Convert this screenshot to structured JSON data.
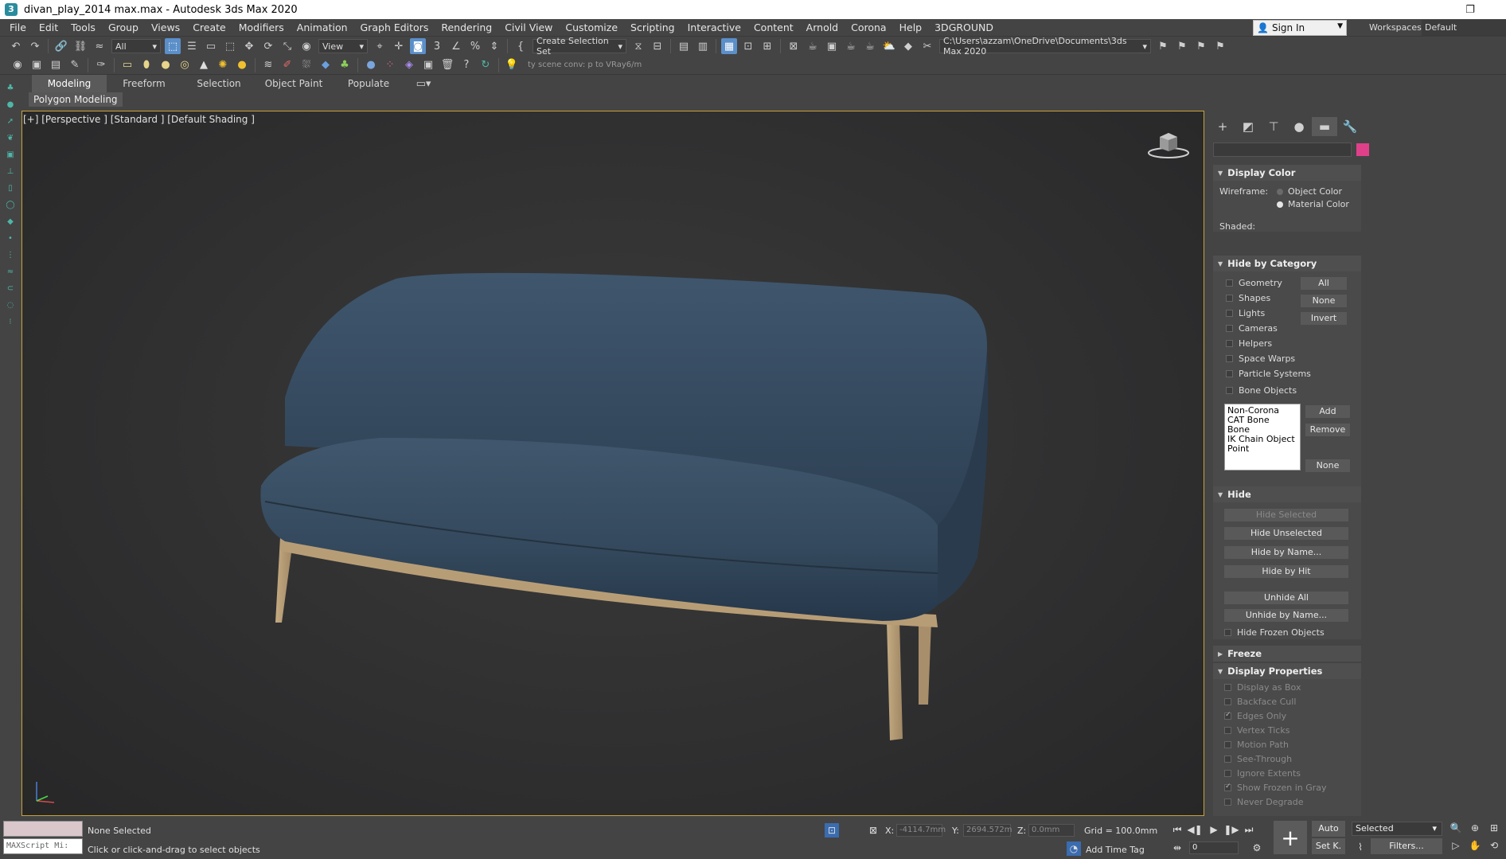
{
  "window": {
    "title": "divan_play_2014 max.max - Autodesk 3ds Max 2020",
    "restore_glyph": "❐"
  },
  "menu": [
    "File",
    "Edit",
    "Tools",
    "Group",
    "Views",
    "Create",
    "Modifiers",
    "Animation",
    "Graph Editors",
    "Rendering",
    "Civil View",
    "Customize",
    "Scripting",
    "Interactive",
    "Content",
    "Arnold",
    "Corona",
    "Help",
    "3DGROUND"
  ],
  "account": {
    "sign_in": "Sign In",
    "workspaces_label": "Workspaces:",
    "workspace": "Default"
  },
  "toolbar1": {
    "selection_filter": "All",
    "ref_coord": "View",
    "selection_set": "Create Selection Set",
    "project_path": "C:\\Users\\azzam\\OneDrive\\Documents\\3ds Max 2020"
  },
  "toolbar2": {
    "hint": "ty scene conv: p to VRay6/m"
  },
  "ribbon": {
    "tabs": [
      "Modeling",
      "Freeform",
      "Selection",
      "Object Paint",
      "Populate"
    ],
    "sub": "Polygon Modeling"
  },
  "viewport": {
    "label": "[+] [Perspective ] [Standard ] [Default Shading ]"
  },
  "cmdpanel": {
    "swatch_color": "#e0408a",
    "display_color": {
      "title": "Display Color",
      "wireframe": "Wireframe:",
      "shaded": "Shaded:",
      "object_color": "Object Color",
      "material_color": "Material Color"
    },
    "hide_by_category": {
      "title": "Hide by Category",
      "categories": [
        "Geometry",
        "Shapes",
        "Lights",
        "Cameras",
        "Helpers",
        "Space Warps",
        "Particle Systems",
        "Bone Objects"
      ],
      "all": "All",
      "none": "None",
      "invert": "Invert",
      "list": [
        "Non-Corona",
        "CAT Bone",
        "Bone",
        "IK Chain Object",
        "Point"
      ],
      "add": "Add",
      "remove": "Remove",
      "none2": "None"
    },
    "hide": {
      "title": "Hide",
      "hide_selected": "Hide Selected",
      "hide_unselected": "Hide Unselected",
      "hide_by_name": "Hide by Name...",
      "hide_by_hit": "Hide by Hit",
      "unhide_all": "Unhide All",
      "unhide_by_name": "Unhide by Name...",
      "hide_frozen": "Hide Frozen Objects"
    },
    "freeze": {
      "title": "Freeze"
    },
    "display_properties": {
      "title": "Display Properties",
      "items": [
        "Display as Box",
        "Backface Cull",
        "Edges Only",
        "Vertex Ticks",
        "Motion Path",
        "See-Through",
        "Ignore Extents",
        "Show Frozen in Gray",
        "Never Degrade"
      ]
    }
  },
  "status": {
    "maxscript": "MAXScript Mi:",
    "selection": "None Selected",
    "prompt": "Click or click-and-drag to select objects",
    "x_label": "X:",
    "x_value": "-4114.7mm",
    "y_label": "Y:",
    "y_value": "2694.572m",
    "z_label": "Z:",
    "z_value": "0.0mm",
    "grid": "Grid = 100.0mm",
    "add_time_tag": "Add Time Tag",
    "frame": "0",
    "auto": "Auto",
    "set_key": "Set K.",
    "key_filter": "Selected",
    "filters": "Filters..."
  }
}
